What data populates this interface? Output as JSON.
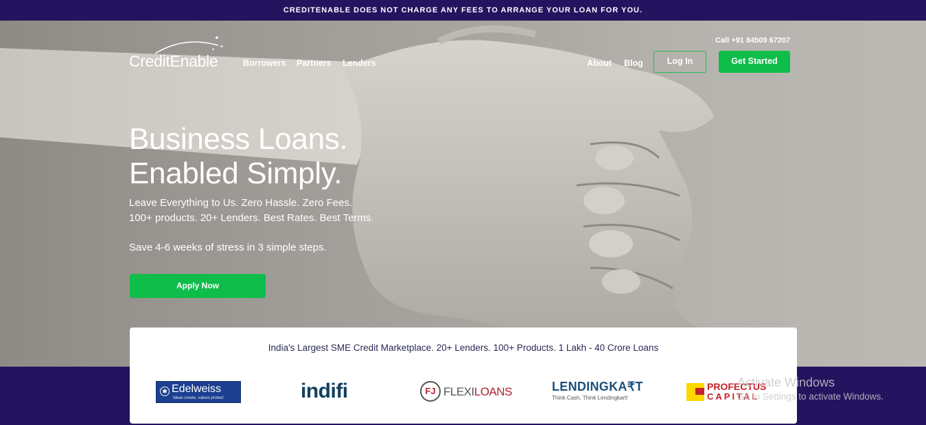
{
  "announcement": "CREDITENABLE DOES NOT CHARGE ANY FEES TO ARRANGE YOUR LOAN FOR YOU.",
  "brand": {
    "name": "CreditEnable",
    "logo_icon": "sparkle-arc-icon"
  },
  "nav_left": [
    {
      "label": "Borrowers"
    },
    {
      "label": "Partners"
    },
    {
      "label": "Lenders"
    }
  ],
  "nav_right": [
    {
      "label": "About"
    },
    {
      "label": "Blog"
    }
  ],
  "call": "Call +91 84509 67207",
  "login_label": "Log In",
  "get_started_label": "Get Started",
  "hero": {
    "headline_1": "Business Loans.",
    "headline_2": "Enabled Simply.",
    "line_1": "Leave Everything to Us. Zero Hassle. Zero Fees.",
    "line_2": "100+ products. 20+ Lenders. Best Rates. Best Terms.",
    "line_3": "Save 4-6 weeks of stress in 3 simple steps.",
    "apply_label": "Apply Now"
  },
  "marketplace": {
    "tagline": "India's Largest SME Credit Marketplace. 20+ Lenders. 100+ Products. 1 Lakh - 40 Crore Loans",
    "partners": {
      "edelweiss": {
        "name": "Edelweiss",
        "slogan": "Ideas create, values protect"
      },
      "indifi": {
        "name": "indifi"
      },
      "flexiloans": {
        "mark": "FJ",
        "name_a": "FLEXI",
        "name_b": "LOANS"
      },
      "lendingkart": {
        "name": "LENDINGKA₹T",
        "slogan": "Think Cash, Think Lendingkart!"
      },
      "profectus": {
        "line_1": "PROFECTUS",
        "line_2": "CAPITAL"
      }
    }
  },
  "watermark": {
    "title": "Activate Windows",
    "subtitle": "Go to Settings to activate Windows."
  },
  "colors": {
    "brand_purple": "#24135f",
    "accent_green": "#0fbd4a"
  }
}
